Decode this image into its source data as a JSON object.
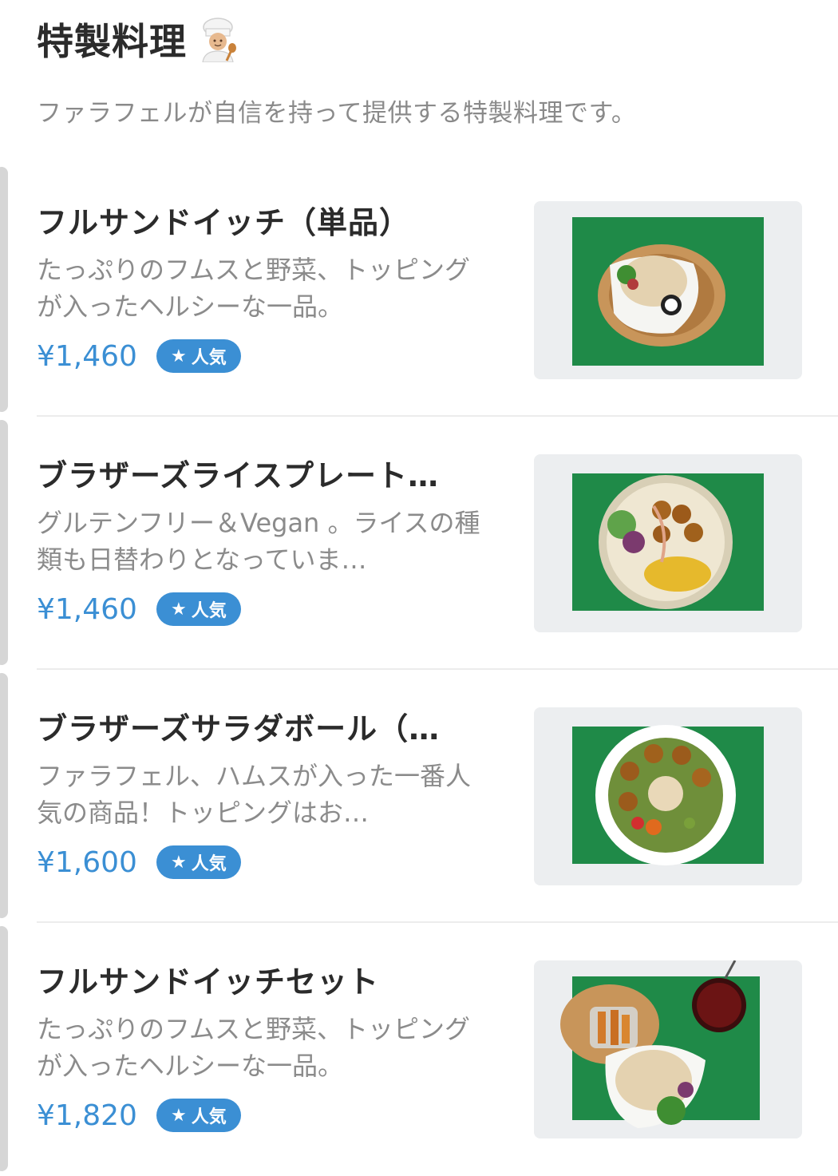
{
  "section": {
    "title": "特製料理",
    "subtitle": "ファラフェルが自信を持って提供する特製料理です。"
  },
  "items": [
    {
      "name": "フルサンドイッチ（単品）",
      "description": "たっぷりのフムスと野菜、トッピングが入ったヘルシーな一品。",
      "price": "¥1,460",
      "badge": "人気"
    },
    {
      "name": "ブラザーズライスプレート…",
      "description": "グルテンフリー＆Vegan 。ライスの種類も日替わりとなっていま…",
      "price": "¥1,460",
      "badge": "人気"
    },
    {
      "name": "ブラザーズサラダボール（…",
      "description": "ファラフェル、ハムスが入った一番人気の商品！トッピングはお…",
      "price": "¥1,600",
      "badge": "人気"
    },
    {
      "name": "フルサンドイッチセット",
      "description": "たっぷりのフムスと野菜、トッピングが入ったヘルシーな一品。",
      "price": "¥1,820",
      "badge": "人気"
    }
  ],
  "colors": {
    "accent": "#3b8fd4",
    "napkin_green": "#1f8a48",
    "title_text": "#2b2b2b",
    "muted_text": "#8b8b8b"
  },
  "icons": {
    "header": "chef-emoji-icon",
    "badge": "star-icon"
  }
}
